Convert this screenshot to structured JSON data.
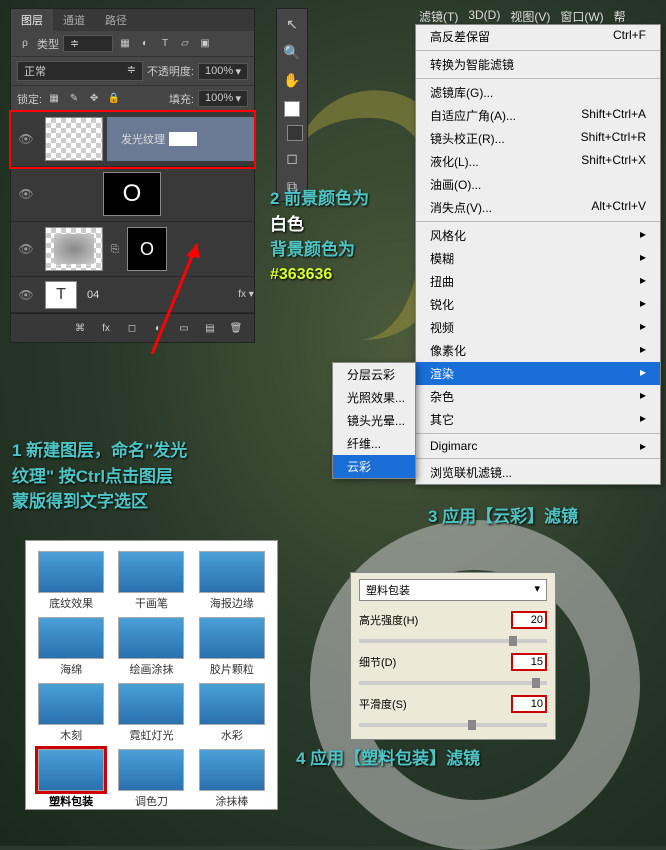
{
  "layers_panel": {
    "tabs": [
      "图层",
      "通道",
      "路径"
    ],
    "type_label": "类型",
    "blend": "正常",
    "opacity_label": "不透明度:",
    "opacity_value": "100%",
    "lock_label": "锁定:",
    "fill_label": "填充:",
    "fill_value": "100%",
    "layer1_name": "发光纹理",
    "layer_text_O": "O",
    "layer_04": "04"
  },
  "annotations": {
    "step2a": "2 前景颜色为",
    "step2b": "白色",
    "step2c": "背景颜色为",
    "step2d": "#363636",
    "step1a": "1 新建图层，命名\"发光",
    "step1b": "纹理\" 按Ctrl点击图层",
    "step1c": "蒙版得到文字选区",
    "step3": "3 应用【云彩】滤镜",
    "step4": "4 应用【塑料包装】滤镜"
  },
  "menubar": [
    "滤镜(T)",
    "3D(D)",
    "视图(V)",
    "窗口(W)",
    "帮"
  ],
  "filter_menu": {
    "items": [
      {
        "label": "高反差保留",
        "shortcut": "Ctrl+F"
      },
      {
        "sep": true
      },
      {
        "label": "转换为智能滤镜"
      },
      {
        "sep": true
      },
      {
        "label": "滤镜库(G)..."
      },
      {
        "label": "自适应广角(A)...",
        "shortcut": "Shift+Ctrl+A"
      },
      {
        "label": "镜头校正(R)...",
        "shortcut": "Shift+Ctrl+R"
      },
      {
        "label": "液化(L)...",
        "shortcut": "Shift+Ctrl+X"
      },
      {
        "label": "油画(O)..."
      },
      {
        "label": "消失点(V)...",
        "shortcut": "Alt+Ctrl+V"
      },
      {
        "sep": true
      },
      {
        "label": "风格化",
        "arrow": true
      },
      {
        "label": "模糊",
        "arrow": true
      },
      {
        "label": "扭曲",
        "arrow": true
      },
      {
        "label": "锐化",
        "arrow": true
      },
      {
        "label": "视频",
        "arrow": true
      },
      {
        "label": "像素化",
        "arrow": true
      },
      {
        "label": "渲染",
        "arrow": true,
        "selected": true
      },
      {
        "label": "杂色",
        "arrow": true
      },
      {
        "label": "其它",
        "arrow": true
      },
      {
        "sep": true
      },
      {
        "label": "Digimarc",
        "arrow": true
      },
      {
        "sep": true
      },
      {
        "label": "浏览联机滤镜..."
      }
    ]
  },
  "render_submenu": {
    "items": [
      "分层云彩",
      "光照效果...",
      "镜头光晕...",
      "纤维...",
      "云彩"
    ],
    "selected": "云彩"
  },
  "gallery": {
    "items": [
      "底纹效果",
      "干画笔",
      "海报边缘",
      "海绵",
      "绘画涂抹",
      "胶片颗粒",
      "木刻",
      "霓虹灯光",
      "水彩",
      "塑料包装",
      "调色刀",
      "涂抹棒"
    ],
    "selected": "塑料包装"
  },
  "settings": {
    "title": "塑料包装",
    "rows": [
      {
        "label": "高光强度(H)",
        "value": "20",
        "knob": 80
      },
      {
        "label": "细节(D)",
        "value": "15",
        "knob": 92
      },
      {
        "label": "平滑度(S)",
        "value": "10",
        "knob": 58
      }
    ]
  }
}
